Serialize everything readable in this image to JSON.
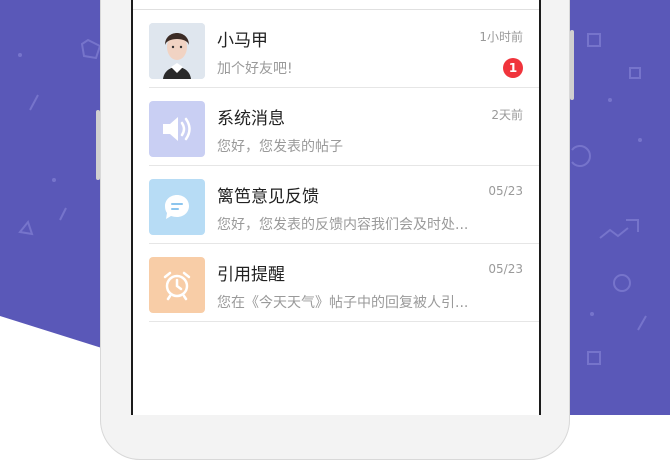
{
  "messages": [
    {
      "title": "小马甲",
      "time": "1小时前",
      "preview": "加个好友吧!",
      "badge": "1",
      "avatar": "user-photo",
      "avatar_bg": "#d7dde4"
    },
    {
      "title": "系统消息",
      "time": "2天前",
      "preview": "您好，您发表的帖子",
      "avatar": "speaker-icon",
      "avatar_bg": "#c9cff3"
    },
    {
      "title": "篱笆意见反馈",
      "time": "05/23",
      "preview": "您好，您发表的反馈内容我们会及时处...",
      "avatar": "chat-bubble-icon",
      "avatar_bg": "#b7dcf5"
    },
    {
      "title": "引用提醒",
      "time": "05/23",
      "preview": "您在《今天天气》帖子中的回复被人引...",
      "avatar": "alarm-clock-icon",
      "avatar_bg": "#f8cda7"
    }
  ],
  "colors": {
    "background_purple": "#5a58b8",
    "badge_red": "#f0343c"
  }
}
